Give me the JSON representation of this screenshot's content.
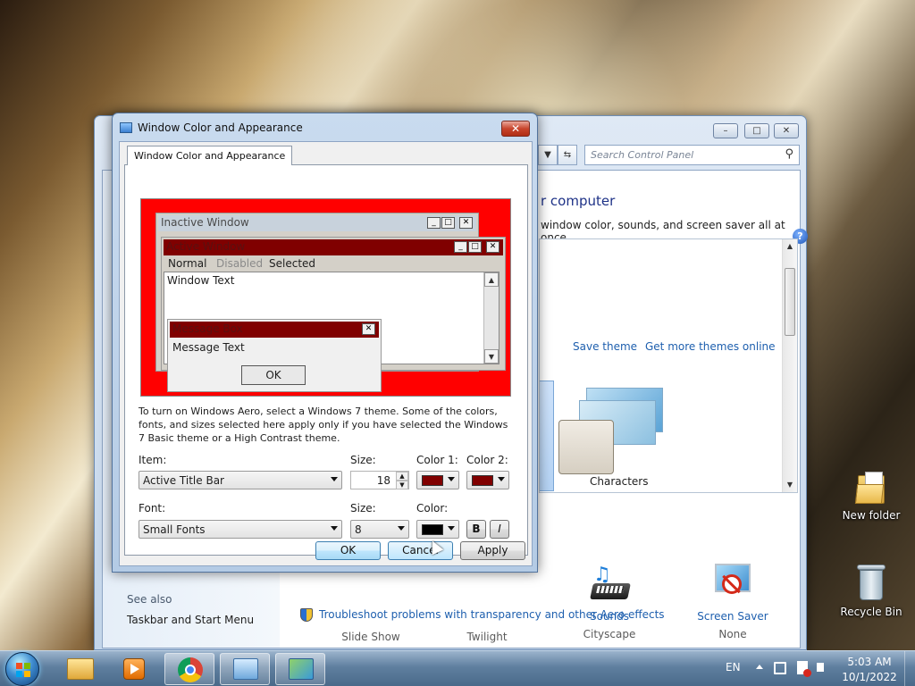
{
  "desktop": {
    "icons": [
      {
        "label": "New folder"
      },
      {
        "label": "Recycle Bin"
      }
    ]
  },
  "control_panel": {
    "search_placeholder": "Search Control Panel",
    "heading": "r computer",
    "subheading": "window color, sounds, and screen saver all at once.",
    "save_theme": "Save theme",
    "more_themes": "Get more themes online",
    "theme_name": "Characters",
    "see_also": "See also",
    "taskbar_link": "Taskbar and Start Menu",
    "bottom_items": [
      {
        "label": "Slide Show",
        "sub": ""
      },
      {
        "label": "Twilight",
        "sub": ""
      },
      {
        "label": "Sounds",
        "sub": "Cityscape"
      },
      {
        "label": "Screen Saver",
        "sub": "None"
      }
    ],
    "troubleshoot_link": "Troubleshoot problems with transparency and other Aero effects"
  },
  "dialog": {
    "title": "Window Color and Appearance",
    "tab_label": "Window Color and Appearance",
    "preview": {
      "inactive_title": "Inactive Window",
      "active_title": "Active Window",
      "menu_normal": "Normal",
      "menu_disabled": "Disabled",
      "menu_selected": "Selected",
      "window_text": "Window Text",
      "message_title": "Message Box",
      "message_text": "Message Text",
      "ok": "OK"
    },
    "info_text": "To turn on Windows Aero, select a Windows 7 theme.  Some of the colors, fonts, and sizes selected here apply only if you have selected the Windows 7 Basic theme or a High Contrast theme.",
    "item_label": "Item:",
    "item_value": "Active Title Bar",
    "size_label": "Size:",
    "size_value": "18",
    "color1_label": "Color 1:",
    "color2_label": "Color 2:",
    "color1": "#800000",
    "color2": "#800000",
    "font_label": "Font:",
    "font_value": "Small Fonts",
    "font_size_label": "Size:",
    "font_size_value": "8",
    "font_color_label": "Color:",
    "font_color": "#000000",
    "bold_label": "B",
    "italic_label": "I",
    "ok": "OK",
    "cancel": "Cancel",
    "apply": "Apply"
  },
  "taskbar": {
    "lang": "EN",
    "time": "5:03 AM",
    "date": "10/1/2022"
  },
  "colors": {
    "preview_bg": "#ff0000",
    "active_title": "#800000",
    "inactive_title": "#c8d2dc"
  }
}
